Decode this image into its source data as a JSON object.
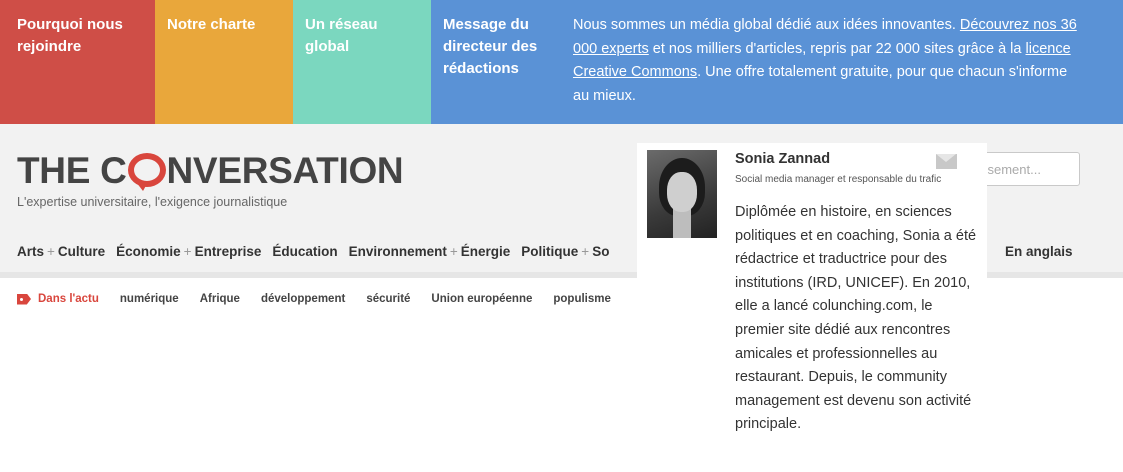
{
  "banner": {
    "tile1": "Pourquoi nous rejoindre",
    "tile2": "Notre charte",
    "tile3": "Un réseau global",
    "tile4": "Message du directeur des rédactions",
    "message": {
      "part1": "Nous sommes un média global dédié aux idées innovantes. ",
      "link1": "Découvrez nos 36 000 experts",
      "part2": " et nos milliers d'articles, repris par 22 000 sites grâce à la ",
      "link2": "licence Creative Commons",
      "part3": ". Une offre totalement gratuite, pour que chacun s'informe au mieux."
    },
    "colors": {
      "red": "#cf4e47",
      "orange": "#e9a73b",
      "teal": "#7bd7bf",
      "blue": "#5a92d6"
    }
  },
  "header": {
    "logo_part1": "THE C",
    "logo_part2": "NVERSATION",
    "tagline": "L'expertise universitaire, l'exigence journalistique",
    "search_placeholder": "ssement..."
  },
  "nav": {
    "items": [
      {
        "a": "Arts",
        "plus": "+",
        "b": "Culture"
      },
      {
        "a": "Économie",
        "plus": "+",
        "b": "Entreprise"
      },
      {
        "a": "Éducation"
      },
      {
        "a": "Environnement",
        "plus": "+",
        "b": "Énergie"
      },
      {
        "a": "Politique",
        "plus": "+",
        "b": "So"
      }
    ],
    "english": "En anglais"
  },
  "trending": {
    "label": "Dans l'actu",
    "icon": "tag-icon",
    "items": [
      "numérique",
      "Afrique",
      "développement",
      "sécurité",
      "Union européenne",
      "populisme"
    ]
  },
  "author_popover": {
    "name": "Sonia Zannad",
    "role": "Social media manager et responsable du trafic",
    "bio": "Diplômée en histoire, en sciences politiques et en coaching, Sonia a été rédactrice et traductrice pour des institutions (IRD, UNICEF). En 2010, elle a lancé colunching.com, le premier site dédié aux rencontres amicales et professionnelles au restaurant. Depuis, le community management est devenu son activité principale.",
    "mail_icon": "mail-icon"
  }
}
